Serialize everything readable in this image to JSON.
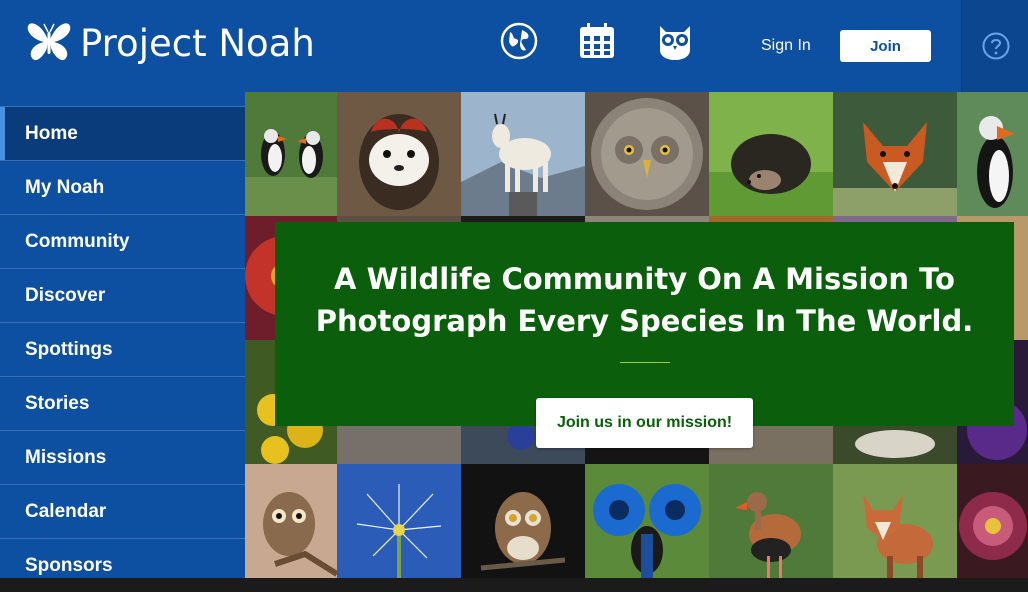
{
  "header": {
    "logo_text": "Project Noah",
    "nav_icons": [
      "globe-icon",
      "calendar-icon",
      "owl-icon"
    ],
    "signin_label": "Sign In",
    "join_label": "Join",
    "help_icon": "question-circle-icon"
  },
  "sidebar": {
    "items": [
      {
        "label": "Home"
      },
      {
        "label": "My Noah"
      },
      {
        "label": "Community"
      },
      {
        "label": "Discover"
      },
      {
        "label": "Spottings"
      },
      {
        "label": "Stories"
      },
      {
        "label": "Missions"
      },
      {
        "label": "Calendar"
      },
      {
        "label": "Sponsors"
      }
    ]
  },
  "mission": {
    "title_line1": "A Wildlife Community On A Mission To",
    "title_line2": "Photograph Every Species In The World.",
    "button_label": "Join us in our mission!"
  },
  "colors": {
    "brand_blue": "#0d4fa0",
    "mission_green": "#0b5e0b",
    "accent_line": "#9ccb3b"
  }
}
